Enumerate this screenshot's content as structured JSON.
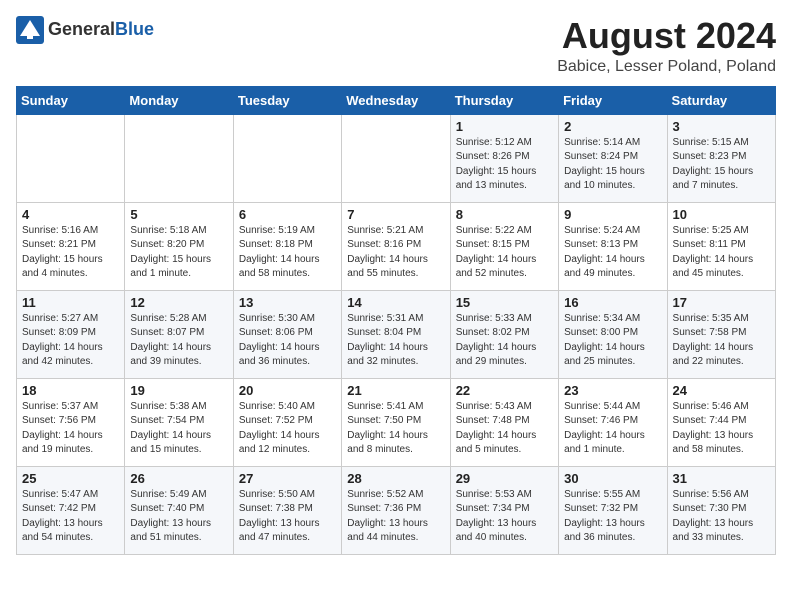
{
  "header": {
    "logo_general": "General",
    "logo_blue": "Blue",
    "month_title": "August 2024",
    "location": "Babice, Lesser Poland, Poland"
  },
  "days_of_week": [
    "Sunday",
    "Monday",
    "Tuesday",
    "Wednesday",
    "Thursday",
    "Friday",
    "Saturday"
  ],
  "weeks": [
    [
      {
        "date": "",
        "info": ""
      },
      {
        "date": "",
        "info": ""
      },
      {
        "date": "",
        "info": ""
      },
      {
        "date": "",
        "info": ""
      },
      {
        "date": "1",
        "info": "Sunrise: 5:12 AM\nSunset: 8:26 PM\nDaylight: 15 hours\nand 13 minutes."
      },
      {
        "date": "2",
        "info": "Sunrise: 5:14 AM\nSunset: 8:24 PM\nDaylight: 15 hours\nand 10 minutes."
      },
      {
        "date": "3",
        "info": "Sunrise: 5:15 AM\nSunset: 8:23 PM\nDaylight: 15 hours\nand 7 minutes."
      }
    ],
    [
      {
        "date": "4",
        "info": "Sunrise: 5:16 AM\nSunset: 8:21 PM\nDaylight: 15 hours\nand 4 minutes."
      },
      {
        "date": "5",
        "info": "Sunrise: 5:18 AM\nSunset: 8:20 PM\nDaylight: 15 hours\nand 1 minute."
      },
      {
        "date": "6",
        "info": "Sunrise: 5:19 AM\nSunset: 8:18 PM\nDaylight: 14 hours\nand 58 minutes."
      },
      {
        "date": "7",
        "info": "Sunrise: 5:21 AM\nSunset: 8:16 PM\nDaylight: 14 hours\nand 55 minutes."
      },
      {
        "date": "8",
        "info": "Sunrise: 5:22 AM\nSunset: 8:15 PM\nDaylight: 14 hours\nand 52 minutes."
      },
      {
        "date": "9",
        "info": "Sunrise: 5:24 AM\nSunset: 8:13 PM\nDaylight: 14 hours\nand 49 minutes."
      },
      {
        "date": "10",
        "info": "Sunrise: 5:25 AM\nSunset: 8:11 PM\nDaylight: 14 hours\nand 45 minutes."
      }
    ],
    [
      {
        "date": "11",
        "info": "Sunrise: 5:27 AM\nSunset: 8:09 PM\nDaylight: 14 hours\nand 42 minutes."
      },
      {
        "date": "12",
        "info": "Sunrise: 5:28 AM\nSunset: 8:07 PM\nDaylight: 14 hours\nand 39 minutes."
      },
      {
        "date": "13",
        "info": "Sunrise: 5:30 AM\nSunset: 8:06 PM\nDaylight: 14 hours\nand 36 minutes."
      },
      {
        "date": "14",
        "info": "Sunrise: 5:31 AM\nSunset: 8:04 PM\nDaylight: 14 hours\nand 32 minutes."
      },
      {
        "date": "15",
        "info": "Sunrise: 5:33 AM\nSunset: 8:02 PM\nDaylight: 14 hours\nand 29 minutes."
      },
      {
        "date": "16",
        "info": "Sunrise: 5:34 AM\nSunset: 8:00 PM\nDaylight: 14 hours\nand 25 minutes."
      },
      {
        "date": "17",
        "info": "Sunrise: 5:35 AM\nSunset: 7:58 PM\nDaylight: 14 hours\nand 22 minutes."
      }
    ],
    [
      {
        "date": "18",
        "info": "Sunrise: 5:37 AM\nSunset: 7:56 PM\nDaylight: 14 hours\nand 19 minutes."
      },
      {
        "date": "19",
        "info": "Sunrise: 5:38 AM\nSunset: 7:54 PM\nDaylight: 14 hours\nand 15 minutes."
      },
      {
        "date": "20",
        "info": "Sunrise: 5:40 AM\nSunset: 7:52 PM\nDaylight: 14 hours\nand 12 minutes."
      },
      {
        "date": "21",
        "info": "Sunrise: 5:41 AM\nSunset: 7:50 PM\nDaylight: 14 hours\nand 8 minutes."
      },
      {
        "date": "22",
        "info": "Sunrise: 5:43 AM\nSunset: 7:48 PM\nDaylight: 14 hours\nand 5 minutes."
      },
      {
        "date": "23",
        "info": "Sunrise: 5:44 AM\nSunset: 7:46 PM\nDaylight: 14 hours\nand 1 minute."
      },
      {
        "date": "24",
        "info": "Sunrise: 5:46 AM\nSunset: 7:44 PM\nDaylight: 13 hours\nand 58 minutes."
      }
    ],
    [
      {
        "date": "25",
        "info": "Sunrise: 5:47 AM\nSunset: 7:42 PM\nDaylight: 13 hours\nand 54 minutes."
      },
      {
        "date": "26",
        "info": "Sunrise: 5:49 AM\nSunset: 7:40 PM\nDaylight: 13 hours\nand 51 minutes."
      },
      {
        "date": "27",
        "info": "Sunrise: 5:50 AM\nSunset: 7:38 PM\nDaylight: 13 hours\nand 47 minutes."
      },
      {
        "date": "28",
        "info": "Sunrise: 5:52 AM\nSunset: 7:36 PM\nDaylight: 13 hours\nand 44 minutes."
      },
      {
        "date": "29",
        "info": "Sunrise: 5:53 AM\nSunset: 7:34 PM\nDaylight: 13 hours\nand 40 minutes."
      },
      {
        "date": "30",
        "info": "Sunrise: 5:55 AM\nSunset: 7:32 PM\nDaylight: 13 hours\nand 36 minutes."
      },
      {
        "date": "31",
        "info": "Sunrise: 5:56 AM\nSunset: 7:30 PM\nDaylight: 13 hours\nand 33 minutes."
      }
    ]
  ]
}
